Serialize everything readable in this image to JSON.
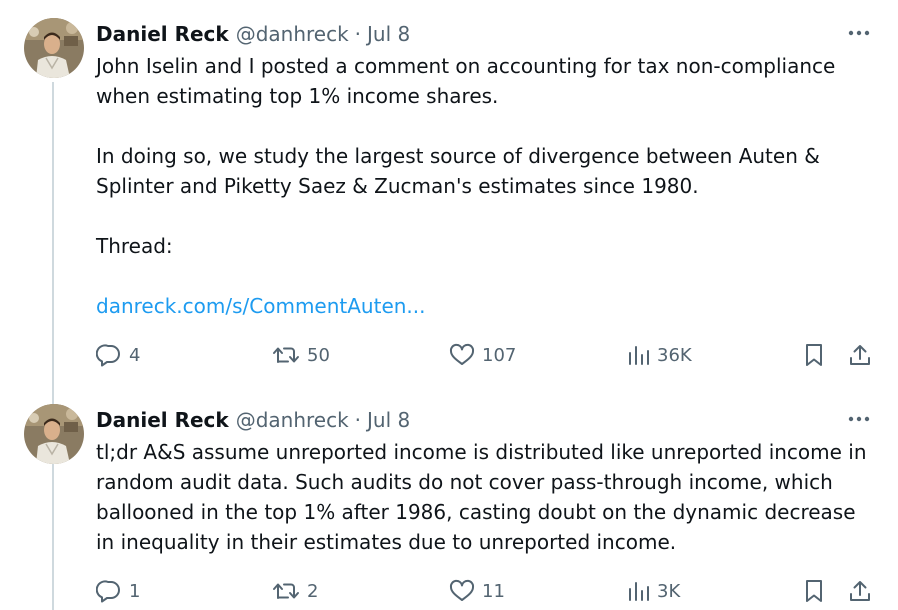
{
  "tweets": [
    {
      "author": {
        "name": "Daniel Reck",
        "handle": "@danhreck",
        "dot": "·",
        "date": "Jul 8"
      },
      "paragraphs": [
        "John Iselin and I posted a comment on accounting for tax non-compliance when estimating top 1% income shares.",
        "In doing so, we study the largest source of divergence between Auten & Splinter and Piketty Saez & Zucman's estimates since 1980.",
        "Thread:"
      ],
      "link": "danreck.com/s/CommentAuten...",
      "stats": {
        "replies": "4",
        "retweets": "50",
        "likes": "107",
        "views": "36K"
      }
    },
    {
      "author": {
        "name": "Daniel Reck",
        "handle": "@danhreck",
        "dot": "·",
        "date": "Jul 8"
      },
      "paragraphs": [
        "tl;dr A&S assume unreported income is distributed like unreported income in random audit data. Such audits do not cover pass-through income, which ballooned in the top 1% after 1986, casting doubt on the dynamic decrease in inequality in their estimates due to unreported income."
      ],
      "stats": {
        "replies": "1",
        "retweets": "2",
        "likes": "11",
        "views": "3K"
      }
    }
  ],
  "icons": {
    "more": "more-horizontal-icon",
    "reply": "reply-bubble-icon",
    "retweet": "retweet-icon",
    "like": "heart-icon",
    "views": "bar-chart-icon",
    "bookmark": "bookmark-icon",
    "share": "share-upload-icon"
  },
  "colors": {
    "text": "#0f1419",
    "secondary": "#536471",
    "link": "#1d9bf0",
    "thread_line": "#cfd9de"
  }
}
